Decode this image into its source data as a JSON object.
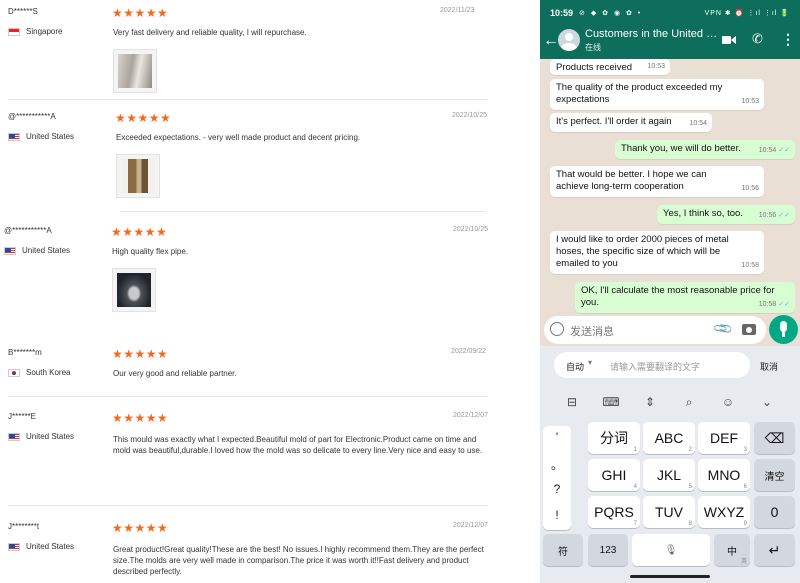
{
  "reviews": [
    {
      "user": "D******S",
      "country": "Singapore",
      "flag": "sg",
      "stars": "★★★★★",
      "date": "2022/11/23",
      "text": "Very fast delivery and reliable quality, I will repurchase."
    },
    {
      "user": "@***********A",
      "country": "United States",
      "flag": "us",
      "stars": "★★★★★",
      "date": "2022/10/25",
      "text": "Exceeded expectations. - very well made product and decent pricing."
    },
    {
      "user": "@***********A",
      "country": "United States",
      "flag": "us",
      "stars": "★★★★★",
      "date": "2022/10/25",
      "text": "High quality flex pipe."
    },
    {
      "user": "B*******m",
      "country": "South Korea",
      "flag": "kr",
      "stars": "★★★★★",
      "date": "2022/09/22",
      "text": "Our very good and reliable partner."
    },
    {
      "user": "J******E",
      "country": "United States",
      "flag": "us",
      "stars": "★★★★★",
      "date": "2022/12/07",
      "text": "This mould was exactly what I expected.Beautiful mold of part for Electronic.Product came on time and mold was beautiful,durable.I loved how the mold was so delicate to every line.Very nice and easy to use."
    },
    {
      "user": "J********t",
      "country": "United States",
      "flag": "us",
      "stars": "★★★★★",
      "date": "2022/12/07",
      "text": "Great product!Great quality!These are the best! No issues.I highly recommend them.They are the perfect size.The molds are very well made in comparison.The price it was worth it!!Fast delivery and product described perfectly."
    }
  ],
  "phone": {
    "status": {
      "time": "10:59",
      "icons": "⊘ ◆ ✿ ◉ ✿ •",
      "right": "VPN ✱ ⏰ ⋮ıl ⋮ıl 🔋"
    },
    "header": {
      "title": "Customers in the United States",
      "status": "在线"
    },
    "messages": [
      {
        "dir": "in",
        "text": "Products received",
        "time": "10:53"
      },
      {
        "dir": "in",
        "text": "The quality of the product exceeded my expectations",
        "time": "10:53"
      },
      {
        "dir": "in",
        "text": "It's perfect. I'll order it again",
        "time": "10:54"
      },
      {
        "dir": "out",
        "text": "Thank you, we will do better.",
        "time": "10:54"
      },
      {
        "dir": "in",
        "text": "That would be better. I hope we can achieve long-term cooperation",
        "time": "10:56"
      },
      {
        "dir": "out",
        "text": "Yes, I think so, too.",
        "time": "10:56"
      },
      {
        "dir": "in",
        "text": "I would like to order 2000 pieces of metal hoses, the specific size of which will be emailed to you",
        "time": "10:58"
      },
      {
        "dir": "out",
        "text": "OK, I'll calculate the most reasonable price for you.",
        "time": "10:58"
      }
    ],
    "input_placeholder": "发送消息",
    "translate": {
      "mode": "自动",
      "placeholder": "请输入需要翻译的文字",
      "cancel": "取消"
    },
    "keyboard": {
      "left_col": [
        "'",
        "。",
        "?",
        "!"
      ],
      "row1": [
        "分词",
        "ABC",
        "DEF"
      ],
      "row1_subs": [
        "1",
        "2",
        "3"
      ],
      "row2": [
        "GHI",
        "JKL",
        "MNO"
      ],
      "row2_subs": [
        "4",
        "5",
        "6"
      ],
      "row3": [
        "PQRS",
        "TUV",
        "WXYZ"
      ],
      "row3_subs": [
        "7",
        "8",
        "9"
      ],
      "clear": "清空",
      "zero": "0",
      "symbol": "符",
      "num": "123",
      "zh": "中",
      "zh_sub": "英"
    }
  }
}
